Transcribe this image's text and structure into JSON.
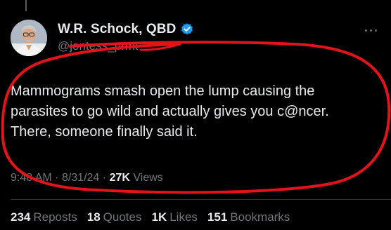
{
  "author": {
    "display_name": "W.R. Schock, QBD",
    "handle": "@jontess_prmt",
    "avatar_icon": "profile-photo",
    "verified_icon": "verified-badge-icon",
    "verified_color": "#1d9bf0"
  },
  "tweet": {
    "lines": [
      "Mammograms smash open the lump causing the",
      "parasites to go wild and actually gives you c@ncer.",
      "There, someone finally said it."
    ]
  },
  "meta": {
    "time": "9:48 AM",
    "separator": "·",
    "date": "8/31/24",
    "views_count": "27K",
    "views_label": "Views"
  },
  "stats": {
    "reposts_count": "234",
    "reposts_label": "Reposts",
    "quotes_count": "18",
    "quotes_label": "Quotes",
    "likes_count": "1K",
    "likes_label": "Likes",
    "bookmarks_count": "151",
    "bookmarks_label": "Bookmarks"
  },
  "colors": {
    "background": "#000000",
    "text_primary": "#e7e9ea",
    "text_secondary": "#71767b",
    "annotation_red": "#e3121b"
  }
}
